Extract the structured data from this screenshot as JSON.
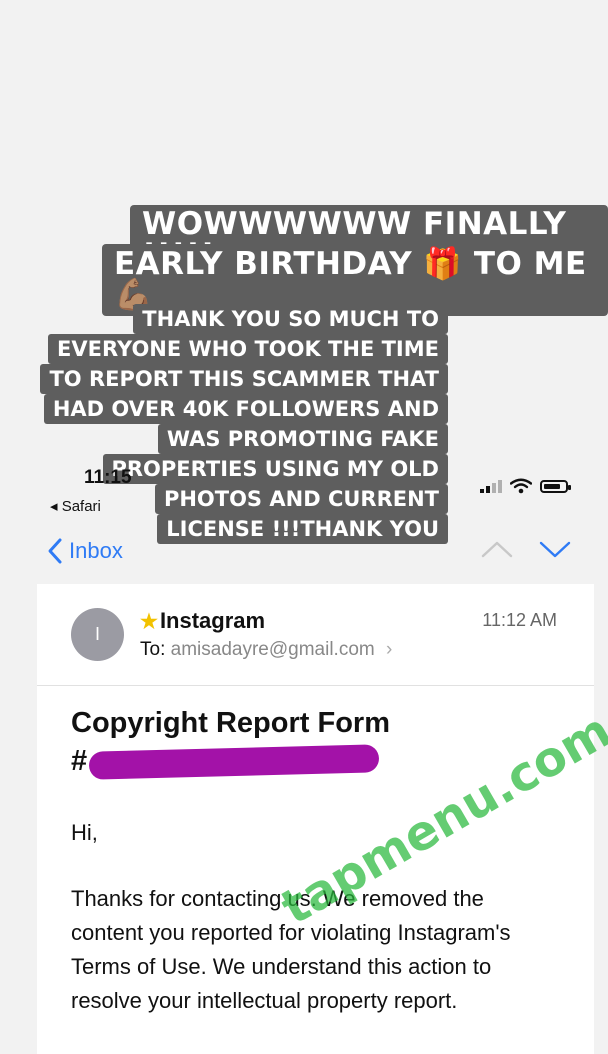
{
  "story": {
    "title_line1": "WOWWWWWW FINALLY !!!!!",
    "title_line2": "EARLY BIRTHDAY 🎁 TO ME 💪🏽",
    "message_lines": [
      "THANK YOU SO MUCH TO",
      "EVERYONE WHO TOOK THE TIME",
      "TO REPORT THIS SCAMMER THAT",
      "HAD OVER 40K FOLLOWERS AND",
      "WAS PROMOTING FAKE",
      "PROPERTIES USING MY OLD",
      "PHOTOS AND CURRENT",
      "LICENSE !!!THANK YOU"
    ]
  },
  "status_bar": {
    "time": "11:15",
    "back_app": "◂ Safari",
    "icons": [
      "cellular-signal-icon",
      "wifi-icon",
      "battery-icon"
    ]
  },
  "nav": {
    "back_label": "Inbox",
    "icons": [
      "chevron-left-icon",
      "chevron-up-icon",
      "chevron-down-icon"
    ]
  },
  "email": {
    "avatar_letter": "I",
    "sender": "Instagram",
    "to_label": "To:",
    "to_address": "amisadayre@gmail.com",
    "time": "11:12 AM",
    "subject_line1": "Copyright Report Form",
    "subject_prefix": "#",
    "greeting": "Hi,",
    "body": "Thanks for contacting us. We removed the content you reported for violating Instagram's Terms of Use. We understand this action to resolve your intellectual property report."
  },
  "watermark": "tapmenu.com",
  "colors": {
    "accent": "#2f7bf5",
    "banner": "#5e5e5e",
    "redaction": "#a312a8",
    "watermark": "#28b93c",
    "star": "#f2c200"
  }
}
